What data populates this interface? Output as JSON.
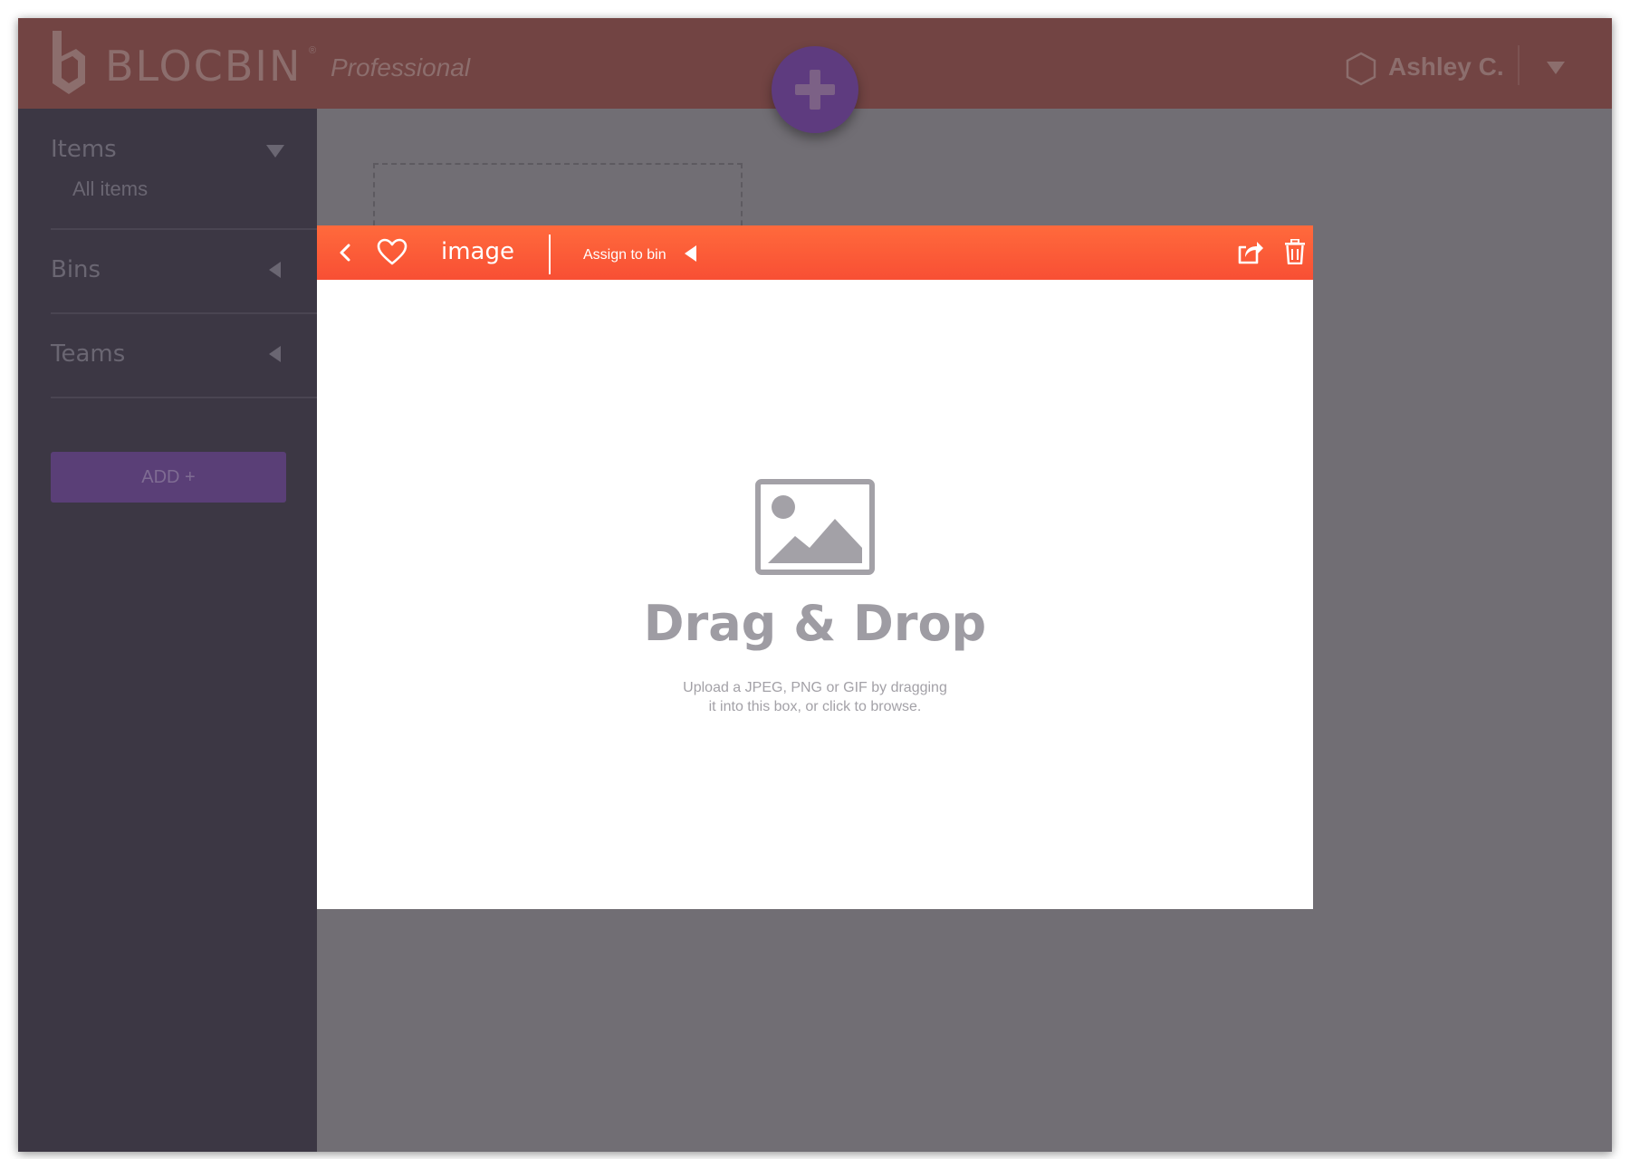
{
  "header": {
    "brand": "BLOCBIN",
    "brand_mark": "®",
    "edition": "Professional",
    "user_name": "Ashley C.",
    "colors": {
      "bar": "#724443",
      "fab": "#5e3b7f"
    }
  },
  "sidebar": {
    "sections": [
      {
        "label": "Items",
        "expanded": true,
        "children": [
          "All items"
        ]
      },
      {
        "label": "Bins",
        "expanded": false
      },
      {
        "label": "Teams",
        "expanded": false
      }
    ],
    "add_button": "ADD +"
  },
  "modal": {
    "toolbar": {
      "title": "image",
      "assign_label": "Assign to bin",
      "icons": [
        "back-icon",
        "heart-icon",
        "share-icon",
        "trash-icon"
      ],
      "color": "#f84f34"
    },
    "dropzone": {
      "icon": "image-placeholder-icon",
      "title": "Drag & Drop",
      "hint_line1": "Upload a JPEG, PNG or GIF by dragging",
      "hint_line2": "it into this box, or click to browse."
    }
  }
}
